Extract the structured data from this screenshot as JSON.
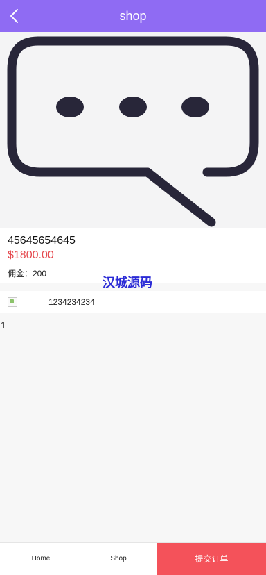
{
  "header": {
    "title": "shop",
    "back_icon": "chevron-left-icon",
    "color": "#8f6bf3"
  },
  "hero": {
    "icon": "chat-bubble-ellipsis-icon",
    "icon_color": "#282639"
  },
  "product": {
    "id": "45645654645",
    "price": "$1800.00",
    "commission": "佣金：200",
    "price_color": "#e5484d"
  },
  "watermark": {
    "text": "汉城源码",
    "color": "#2b2bd6"
  },
  "shop": {
    "name": "1234234234",
    "logo_icon": "broken-image-icon"
  },
  "detail": {
    "text": "1"
  },
  "bottom_bar": {
    "home_label": "Home",
    "shop_label": "Shop",
    "submit_label": "提交订单",
    "submit_color": "#f4525a"
  }
}
